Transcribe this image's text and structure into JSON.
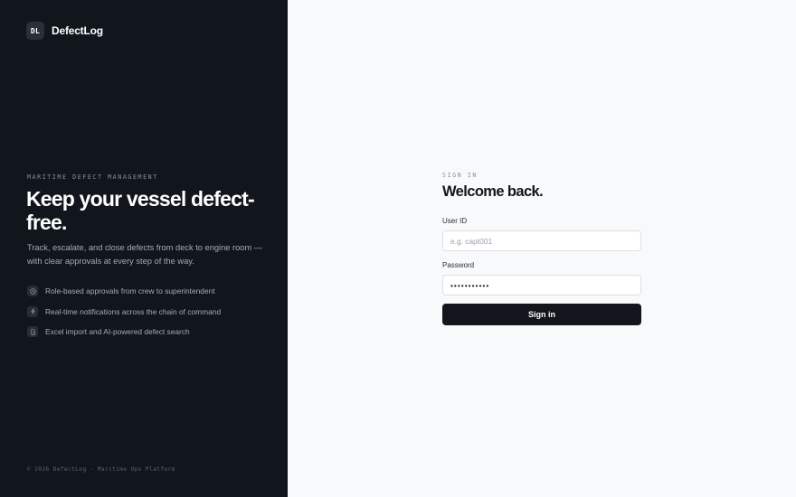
{
  "brand": {
    "mark": "DL",
    "name": "DefectLog"
  },
  "hero": {
    "eyebrow": "MARITIME DEFECT MANAGEMENT",
    "headline": "Keep your vessel defect-free.",
    "description": "Track, escalate, and close defects from deck to engine room — with clear approvals at every step of the way.",
    "features": [
      {
        "icon": "clock-icon",
        "text": "Role-based approvals from crew to superintendent"
      },
      {
        "icon": "bolt-icon",
        "text": "Real-time notifications across the chain of command"
      },
      {
        "icon": "document-icon",
        "text": "Excel import and AI-powered defect search"
      }
    ]
  },
  "footer": {
    "text": "© 2026 DefectLog · Maritime Ops Platform"
  },
  "signin": {
    "kicker": "SIGN IN",
    "title": "Welcome back.",
    "user_id_label": "User ID",
    "user_id_placeholder": "e.g. capt001",
    "user_id_value": "",
    "password_label": "Password",
    "password_value": "•••••••••••",
    "submit_label": "Sign in"
  },
  "colors": {
    "sidebar_bg": "#11151c",
    "page_bg": "#f8f9fb",
    "button_bg": "#12151b"
  }
}
